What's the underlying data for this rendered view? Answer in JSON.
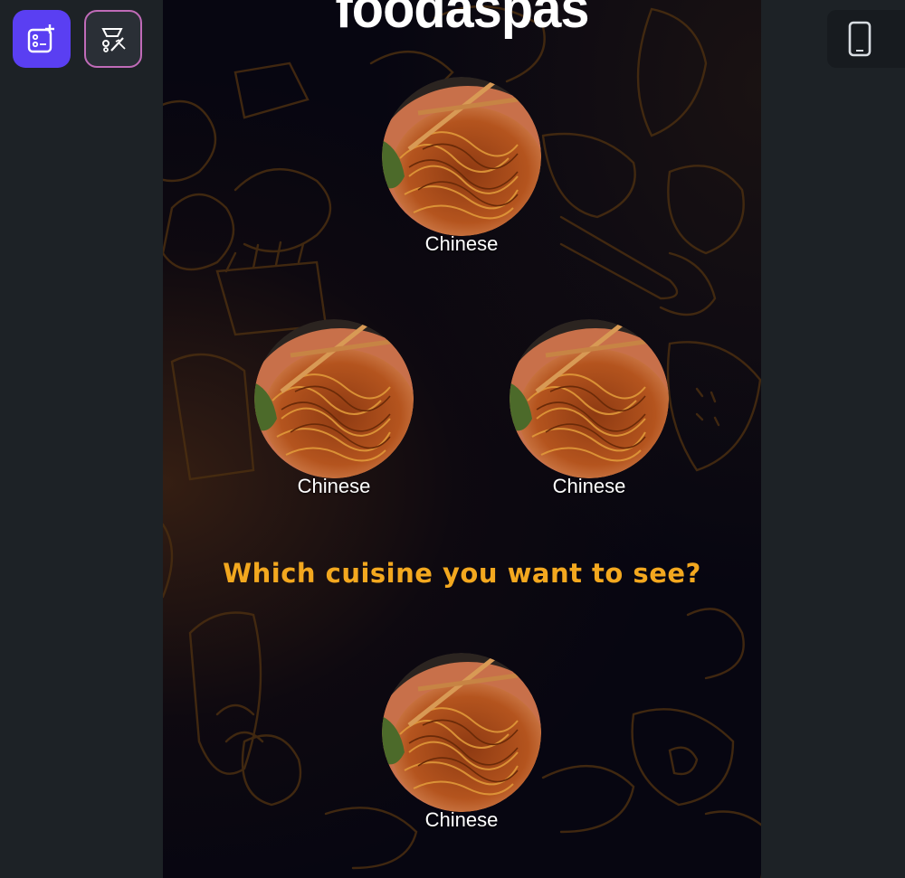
{
  "toolbar": {
    "add_icon": "add-screen-icon",
    "edit_icon": "magic-edit-icon",
    "device_icon": "smartphone-icon"
  },
  "app": {
    "title": "foodaspas",
    "question": "Which cuisine you want to see?",
    "cuisines": [
      {
        "label": "Chinese"
      },
      {
        "label": "Chinese"
      },
      {
        "label": "Chinese"
      },
      {
        "label": "Chinese"
      }
    ]
  },
  "colors": {
    "accent": "#f3a81f",
    "add_button": "#5a3ff2",
    "edit_button_border": "#c06bb8",
    "background": "#1d2226",
    "phone_background": "#070611",
    "doodle_stroke": "#4a2e10"
  }
}
